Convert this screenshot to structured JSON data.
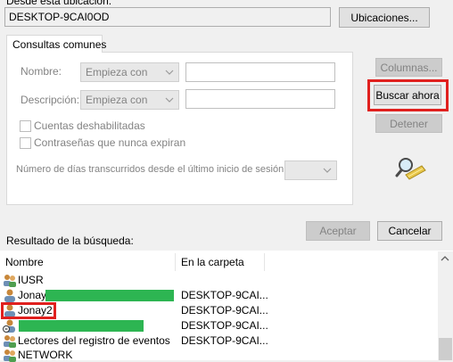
{
  "location": {
    "label": "Desde esta ubicación:",
    "value": "DESKTOP-9CAI0OD",
    "button": "Ubicaciones..."
  },
  "tab": {
    "label": "Consultas comunes"
  },
  "query": {
    "name_label": "Nombre:",
    "name_mode": "Empieza con",
    "desc_label": "Descripción:",
    "desc_mode": "Empieza con",
    "disabled_accounts": "Cuentas deshabilitadas",
    "non_expiring_passwords": "Contraseñas que nunca expiran",
    "days_label": "Número de días transcurridos desde el último inicio de sesión:"
  },
  "buttons": {
    "columns": "Columnas...",
    "search_now": "Buscar ahora",
    "stop": "Detener",
    "ok": "Aceptar",
    "cancel": "Cancelar"
  },
  "results": {
    "label": "Resultado de la búsqueda:",
    "columns": [
      "Nombre",
      "En la carpeta"
    ],
    "rows": [
      {
        "name": "IUSR",
        "folder": ""
      },
      {
        "name": "Jonay",
        "folder": "DESKTOP-9CAI..."
      },
      {
        "name": "Jonay2",
        "folder": "DESKTOP-9CAI..."
      },
      {
        "name": "",
        "folder": "DESKTOP-9CAI..."
      },
      {
        "name": "Lectores del registro de eventos",
        "folder": "DESKTOP-9CAI..."
      },
      {
        "name": "NETWORK",
        "folder": ""
      }
    ]
  },
  "colors": {
    "highlight": "#e0201e",
    "redaction": "#2db552"
  }
}
